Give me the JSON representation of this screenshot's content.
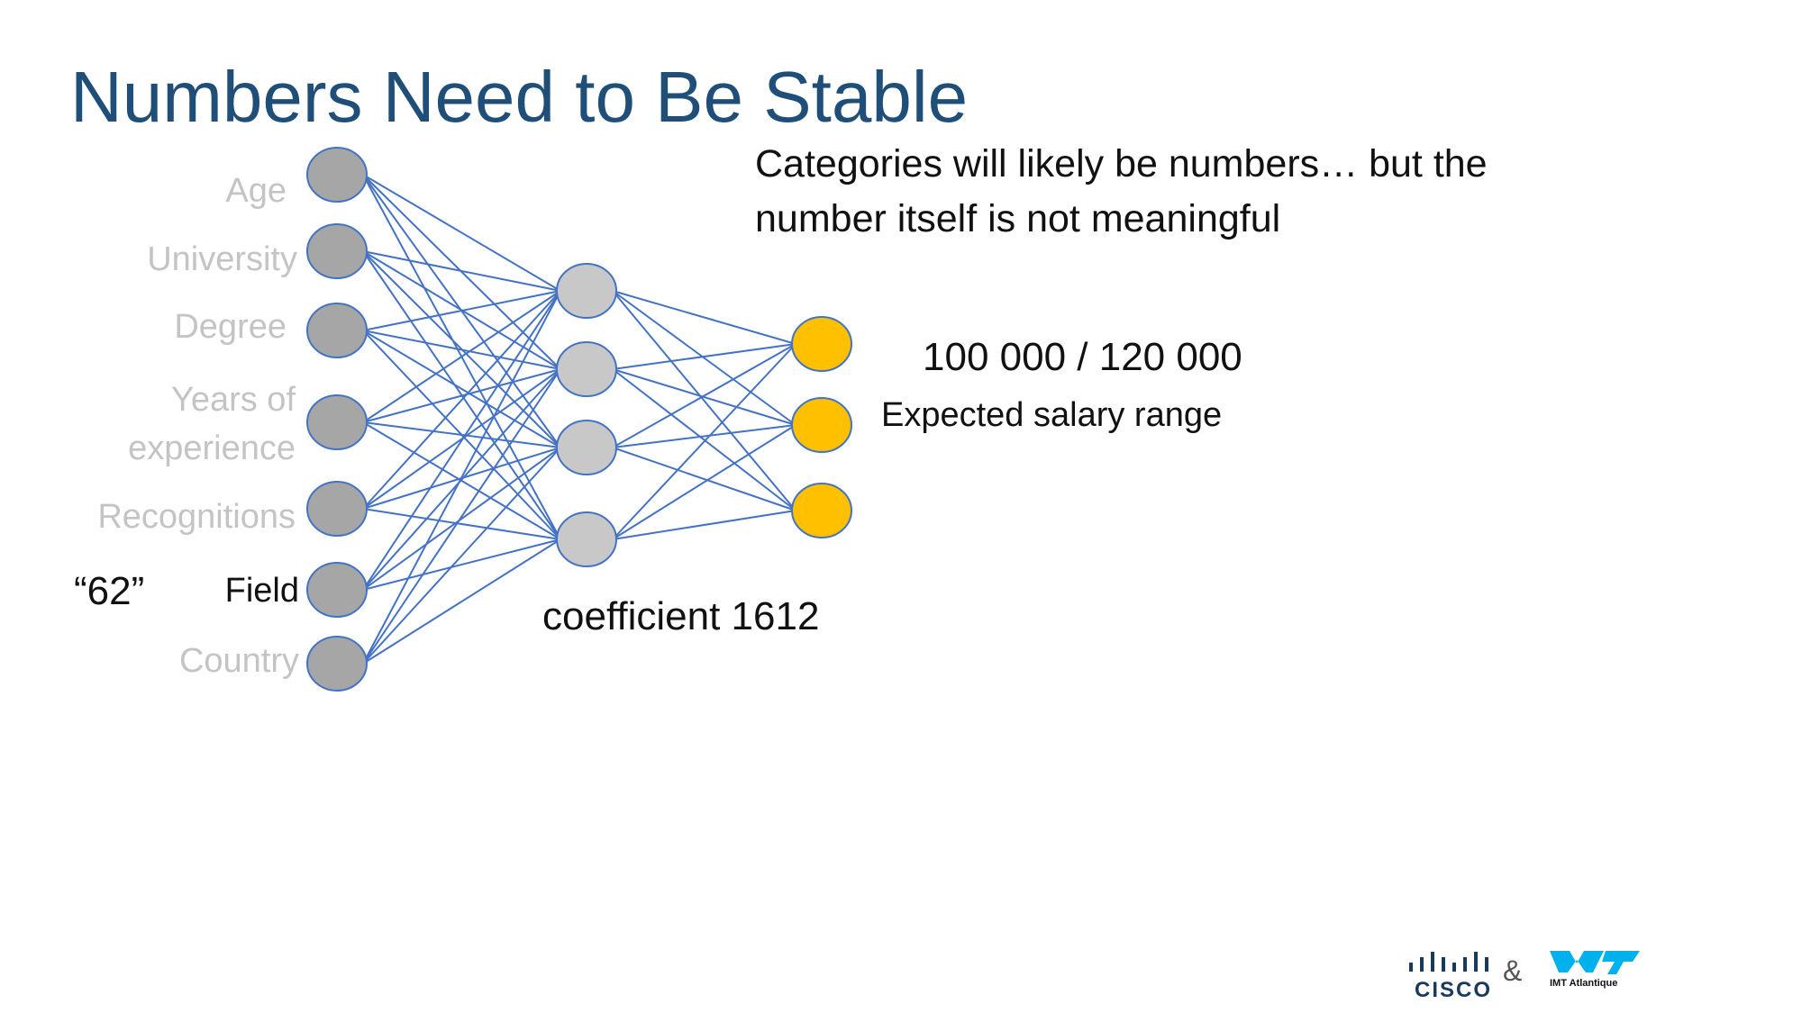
{
  "title": "Numbers Need to Be Stable",
  "note": {
    "line1": "Categories will likely be numbers… but the",
    "line2": "number itself is not meaningful"
  },
  "inputs": {
    "age": "Age",
    "university": "University",
    "degree": "Degree",
    "years_line1": "Years of",
    "years_line2": "experience",
    "recognitions": "Recognitions",
    "field": "Field",
    "country": "Country"
  },
  "field_value": "“62”",
  "coefficient": "coefficient 1612",
  "output_value": "100 000 / 120 000",
  "output_label": "Expected salary range",
  "footer": {
    "cisco": "CISCO",
    "ampersand": "&",
    "imt": "IMT Atlantique"
  },
  "colors": {
    "input_node": "#a6a6a6",
    "hidden_node": "#c8c8c8",
    "output_node": "#ffc000",
    "edge": "#4472c4",
    "title": "#1f4e79"
  }
}
